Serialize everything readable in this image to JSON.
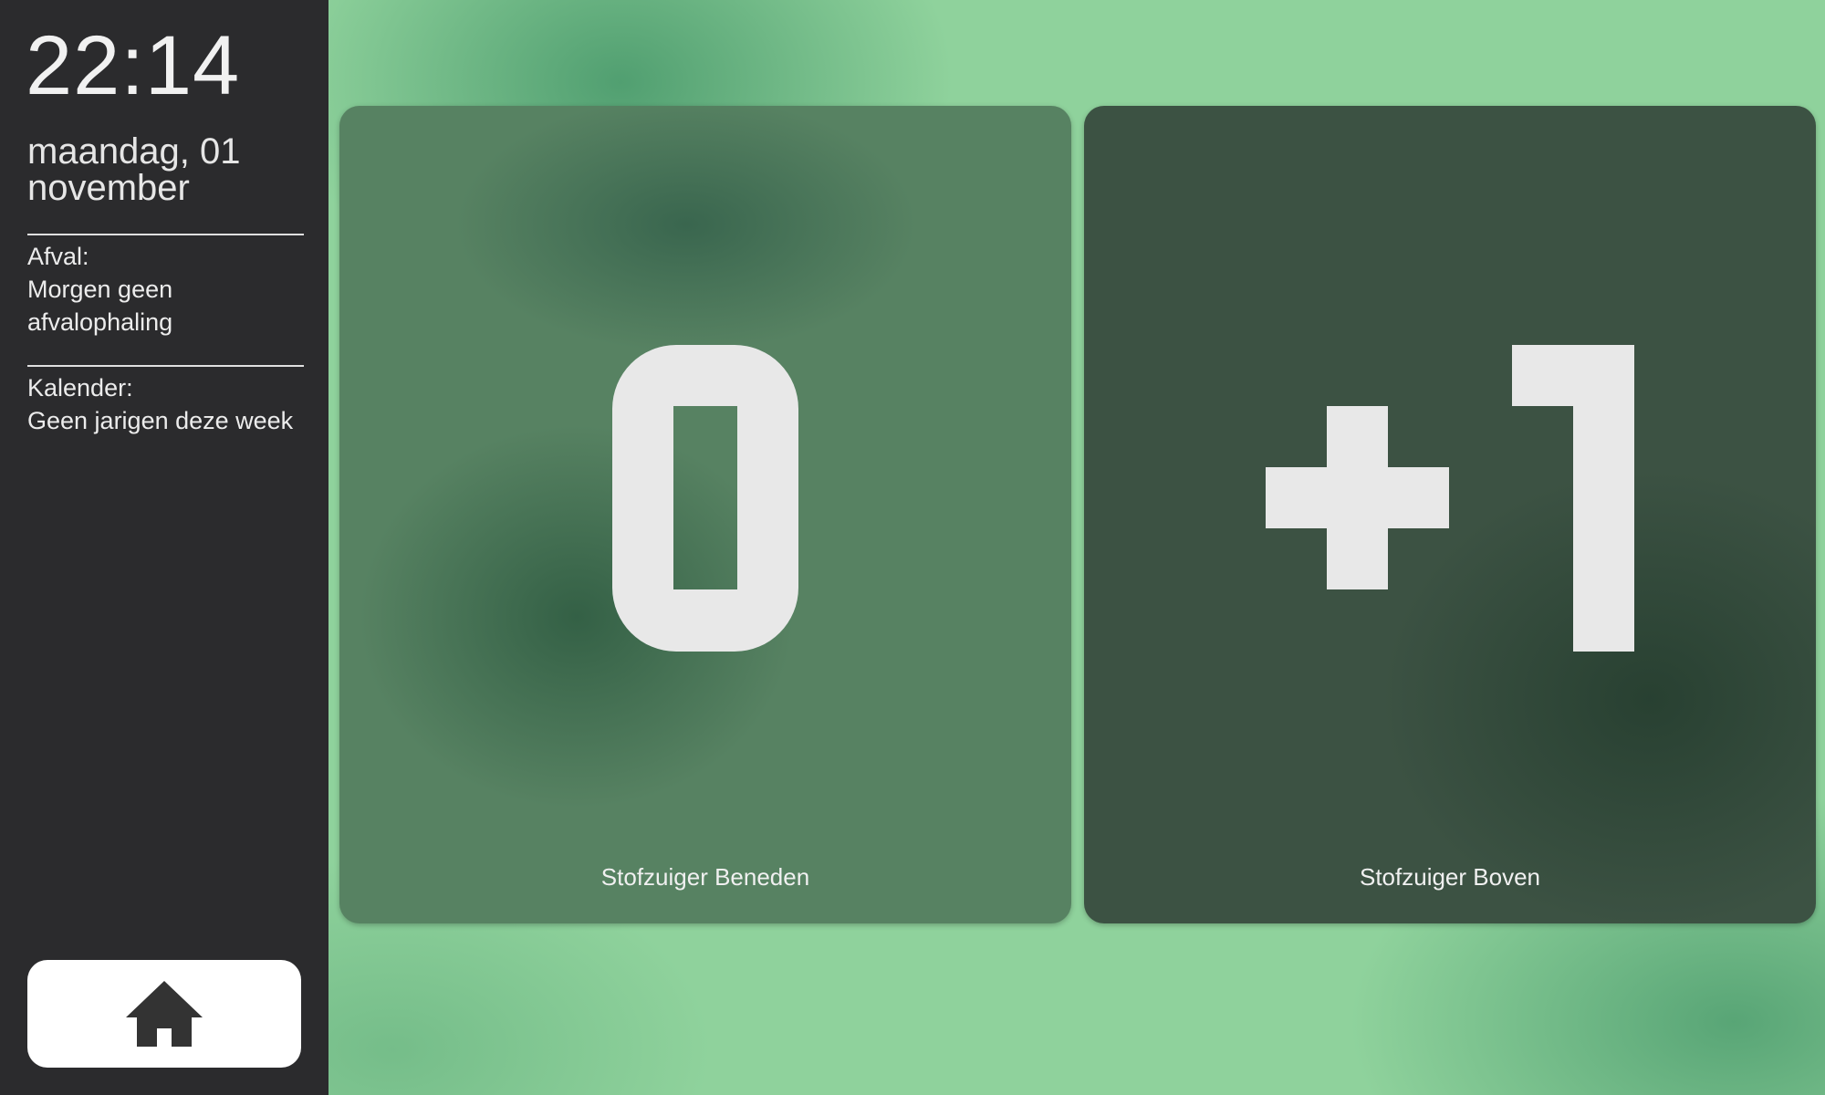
{
  "sidebar": {
    "time": "22:14",
    "date": "maandag, 01 november",
    "afval": {
      "title": "Afval:",
      "text": "Morgen geen afvalophaling"
    },
    "kalender": {
      "title": "Kalender:",
      "text": "Geen jarigen deze week"
    },
    "home_button": {
      "icon": "home-icon"
    }
  },
  "cards": [
    {
      "value": "0",
      "label": "Stofzuiger Beneden"
    },
    {
      "value": "+1",
      "label": "Stofzuiger Boven"
    }
  ],
  "colors": {
    "sidebar_bg": "#2b2b2d",
    "background": "#8fd29c",
    "card_left": "#578262",
    "card_right": "#3c5243",
    "digit": "#e8e8e8"
  }
}
